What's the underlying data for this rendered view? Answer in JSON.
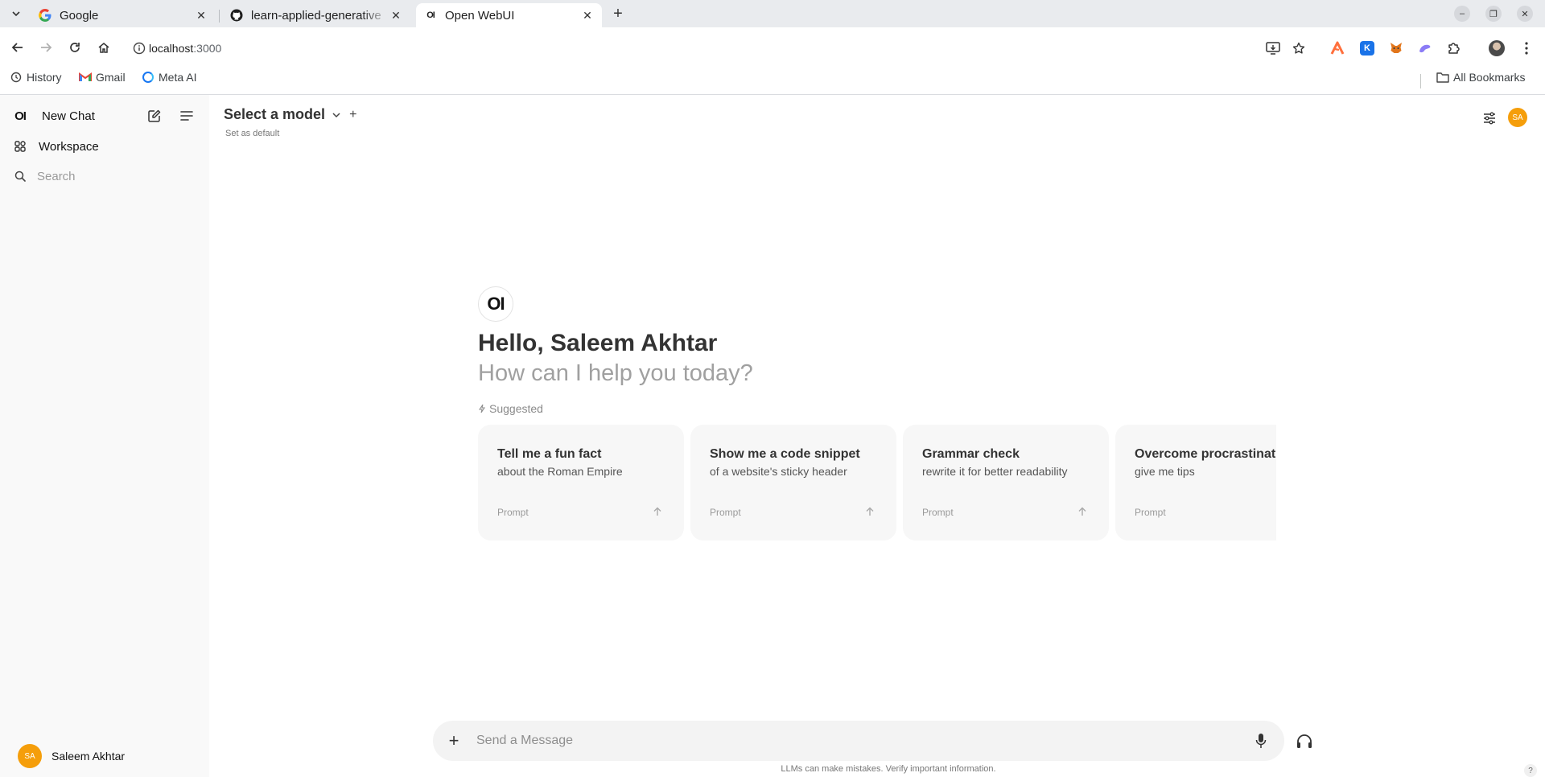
{
  "browser": {
    "tabs": [
      {
        "title": "Google"
      },
      {
        "title": "learn-applied-generative"
      },
      {
        "title": "Open WebUI",
        "favicon_text": "OI"
      }
    ],
    "url_host": "localhost",
    "url_port": ":3000",
    "bookmarks": [
      {
        "label": "History"
      },
      {
        "label": "Gmail"
      },
      {
        "label": "Meta AI"
      }
    ],
    "all_bookmarks": "All Bookmarks",
    "extensions": [
      {
        "name": "toolbar-extension-orange",
        "color": "#ff6f3c"
      },
      {
        "name": "toolbar-extension-k",
        "letter": "K",
        "color": "#1a73e8"
      },
      {
        "name": "toolbar-extension-fox",
        "color": "#e2761b"
      },
      {
        "name": "toolbar-extension-purple",
        "color": "#8b7cf6"
      }
    ]
  },
  "sidebar": {
    "logo_text": "OI",
    "new_chat": "New Chat",
    "workspace": "Workspace",
    "search_placeholder": "Search",
    "user_initials": "SA",
    "user_name": "Saleem Akhtar"
  },
  "header": {
    "model_label": "Select a model",
    "set_default": "Set as default",
    "user_initials": "SA"
  },
  "hero": {
    "logo_text": "OI",
    "greeting": "Hello, Saleem Akhtar",
    "subtitle": "How can I help you today?",
    "suggested_label": "Suggested"
  },
  "suggestions": [
    {
      "title": "Tell me a fun fact",
      "subtitle": "about the Roman Empire",
      "tag": "Prompt"
    },
    {
      "title": "Show me a code snippet",
      "subtitle": "of a website's sticky header",
      "tag": "Prompt"
    },
    {
      "title": "Grammar check",
      "subtitle": "rewrite it for better readability",
      "tag": "Prompt"
    },
    {
      "title": "Overcome procrastination",
      "subtitle": "give me tips",
      "tag": "Prompt"
    }
  ],
  "composer": {
    "placeholder": "Send a Message",
    "disclaimer": "LLMs can make mistakes. Verify important information.",
    "help": "?"
  },
  "colors": {
    "accent_avatar": "#f59e0b",
    "sidebar_bg": "#f9f9f9",
    "card_bg": "#f7f7f7"
  }
}
